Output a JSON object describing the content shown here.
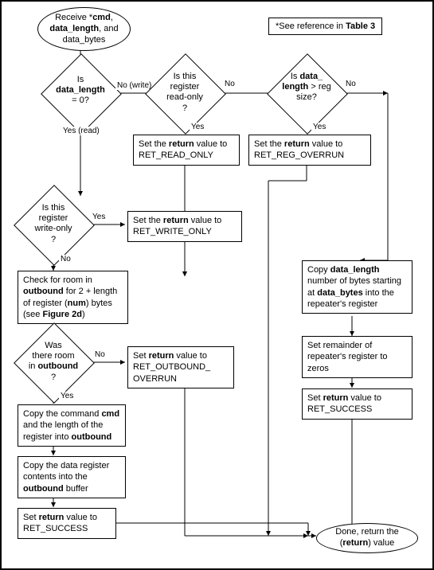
{
  "note": {
    "text_a": "*See reference in ",
    "text_b": "Table 3"
  },
  "start": {
    "l1": "Receive *",
    "cmd": "cmd",
    "l2": ", ",
    "dl": "data_length",
    "l3": ", and data_bytes"
  },
  "d1": {
    "l1": "Is",
    "dl": "data_length",
    "l2": "= 0?"
  },
  "d1_yes": "Yes (read)",
  "d1_no": "No (write)",
  "d2": {
    "l1": "Is this",
    "l2": "register",
    "l3": "read-only",
    "l4": "?"
  },
  "d2_yes": "Yes",
  "d2_no": "No",
  "d3": {
    "l1": "Is ",
    "dl": "data_",
    "dl2": "length",
    "l2": " > reg size?"
  },
  "d3_yes": "Yes",
  "d3_no": "No",
  "p_readonly": {
    "a": "Set the ",
    "b": "return",
    "c": " value to RET_READ_ONLY"
  },
  "p_overrun": {
    "a": "Set the ",
    "b": "return",
    "c": " value to RET_REG_OVERRUN"
  },
  "d4": {
    "l1": "Is this",
    "l2": "register",
    "l3": "write-only",
    "l4": "?"
  },
  "d4_yes": "Yes",
  "d4_no": "No",
  "p_writeonly": {
    "a": "Set the ",
    "b": "return",
    "c": " value to RET_WRITE_ONLY"
  },
  "p_check": {
    "a": "Check for room in ",
    "ob": "outbound",
    "b": " for 2 + length of register (",
    "num": "num",
    "c": ") bytes  (see ",
    "fig": "Figure 2d",
    "d": ")"
  },
  "d5": {
    "l1": "Was",
    "l2": "there room",
    "l3": "in ",
    "ob": "outbound",
    "l4": "?"
  },
  "d5_yes": "Yes",
  "d5_no": "No",
  "p_outover": {
    "a": "Set ",
    "b": "return",
    "c": " value to RET_OUTBOUND_ OVERRUN"
  },
  "p_copycmd": {
    "a": "Copy the command ",
    "cmd": "cmd",
    "b": " and the length of the register into ",
    "ob": "outbound"
  },
  "p_copydata": {
    "a": "Copy the data register contents into the ",
    "ob": "outbound",
    "b": " buffer"
  },
  "p_success1": {
    "a": "Set ",
    "b": "return",
    "c": " value to RET_SUCCESS"
  },
  "p_copybytes": {
    "a": "Copy ",
    "dl": "data_length",
    "b": " number of bytes starting at ",
    "db": "data_bytes",
    "c": " into the repeater's register"
  },
  "p_remainder": {
    "a": "Set remainder of repeater's register to zeros"
  },
  "p_success2": {
    "a": "Set ",
    "b": "return",
    "c": " value to RET_SUCCESS"
  },
  "end": {
    "a": "Done, return the (",
    "b": "return",
    "c": ") value"
  }
}
